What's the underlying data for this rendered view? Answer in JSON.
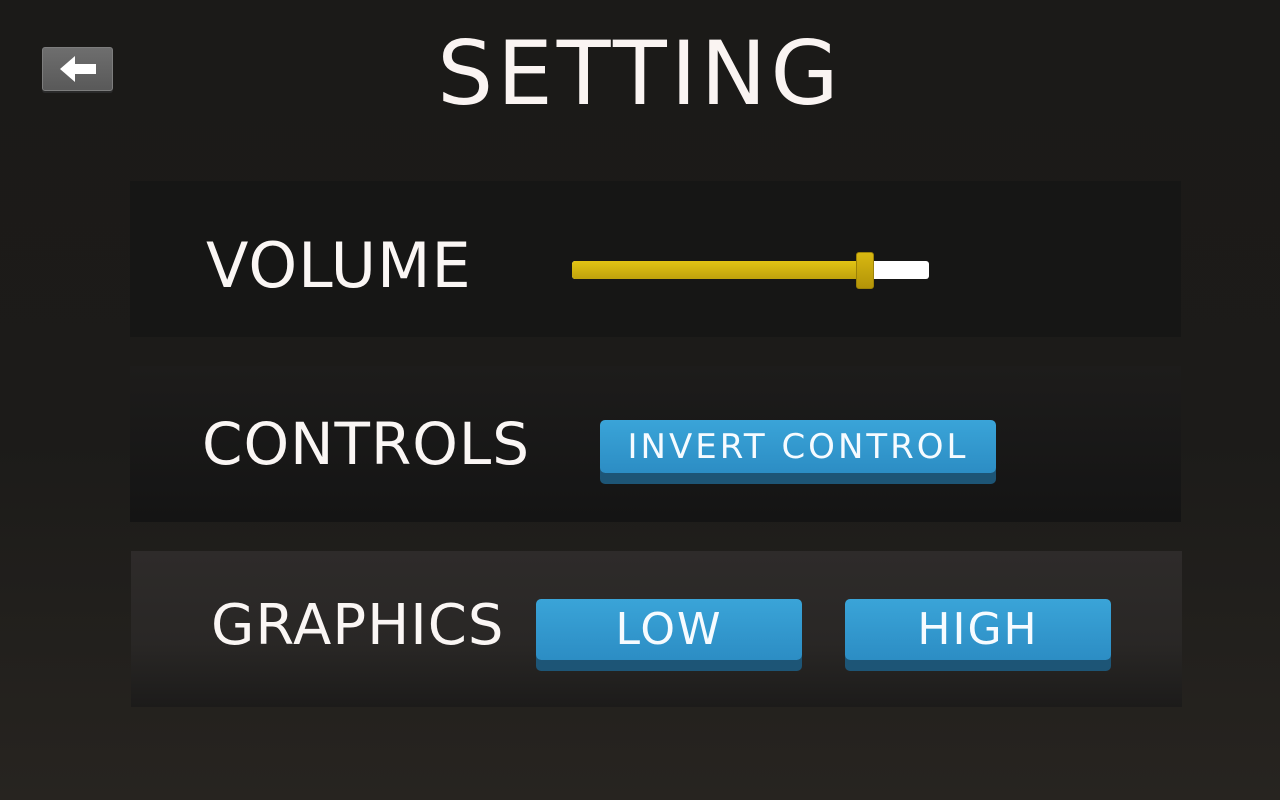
{
  "header": {
    "title": "SETTING",
    "back_icon": "arrow-left-icon"
  },
  "volume": {
    "label": "VOLUME",
    "level": 0.82,
    "fill_color": "#d4b510",
    "track_color": "#ffffff"
  },
  "controls": {
    "label": "CONTROLS",
    "invert_label": "INVERT CONTROL"
  },
  "graphics": {
    "label": "GRAPHICS",
    "options": [
      "LOW",
      "HIGH"
    ]
  },
  "colors": {
    "button_blue": "#3399cc",
    "button_shadow": "#1d5576"
  }
}
